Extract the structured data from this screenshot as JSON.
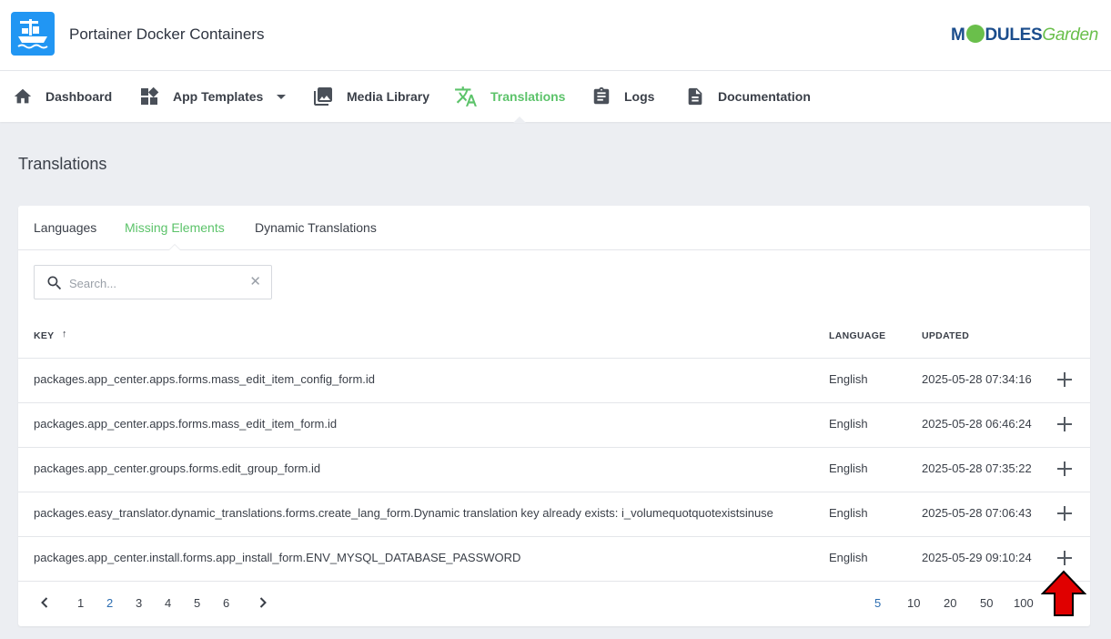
{
  "header": {
    "app_title": "Portainer Docker Containers",
    "brand_part1": "M",
    "brand_part2": "DULES",
    "brand_part3": "Garden"
  },
  "nav": {
    "items": [
      {
        "label": "Dashboard",
        "icon": "home-icon"
      },
      {
        "label": "App Templates",
        "icon": "widgets-icon"
      },
      {
        "label": "Media Library",
        "icon": "image-icon"
      },
      {
        "label": "Translations",
        "icon": "translate-icon",
        "active": true
      },
      {
        "label": "Logs",
        "icon": "clipboard-icon"
      },
      {
        "label": "Documentation",
        "icon": "document-icon"
      }
    ]
  },
  "page": {
    "title": "Translations"
  },
  "tabs": [
    {
      "label": "Languages"
    },
    {
      "label": "Missing Elements",
      "active": true
    },
    {
      "label": "Dynamic Translations"
    }
  ],
  "search": {
    "placeholder": "Search...",
    "value": ""
  },
  "table": {
    "columns": {
      "key": "KEY",
      "language": "LANGUAGE",
      "updated": "UPDATED"
    },
    "sort_indicator": "↑",
    "rows": [
      {
        "key": "packages.app_center.apps.forms.mass_edit_item_config_form.id",
        "language": "English",
        "updated": "2025-05-28 07:34:16"
      },
      {
        "key": "packages.app_center.apps.forms.mass_edit_item_form.id",
        "language": "English",
        "updated": "2025-05-28 06:46:24"
      },
      {
        "key": "packages.app_center.groups.forms.edit_group_form.id",
        "language": "English",
        "updated": "2025-05-28 07:35:22"
      },
      {
        "key": "packages.easy_translator.dynamic_translations.forms.create_lang_form.Dynamic translation key already exists: i_volumequotquotexistsinuse",
        "language": "English",
        "updated": "2025-05-28 07:06:43"
      },
      {
        "key": "packages.app_center.install.forms.app_install_form.ENV_MYSQL_DATABASE_PASSWORD",
        "language": "English",
        "updated": "2025-05-29 09:10:24"
      }
    ]
  },
  "pagination": {
    "pages": [
      "1",
      "2",
      "3",
      "4",
      "5",
      "6"
    ],
    "current_page": "2",
    "page_sizes": [
      "5",
      "10",
      "20",
      "50",
      "100"
    ],
    "current_size": "5"
  },
  "colors": {
    "accent": "#5cc36a",
    "app_icon": "#2196f3",
    "annotation_arrow": "#e00000"
  }
}
